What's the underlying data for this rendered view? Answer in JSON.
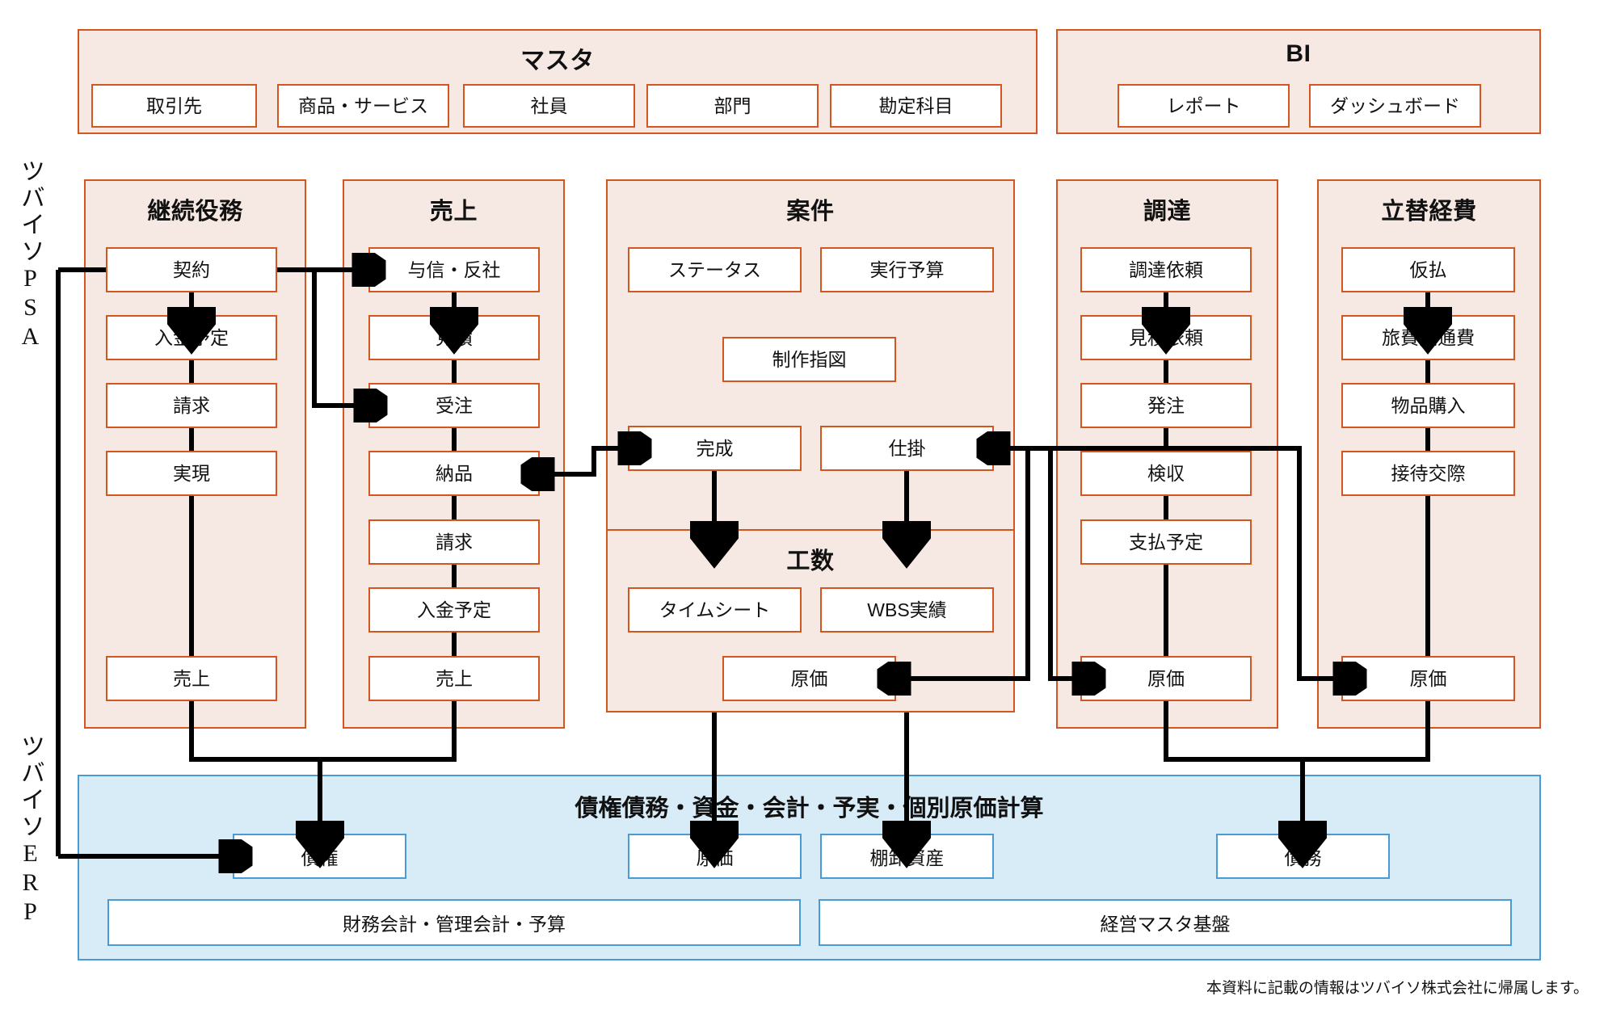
{
  "side_labels": {
    "psa": "ツバイソPSA",
    "erp": "ツバイソERP"
  },
  "footer": "本資料に記載の情報はツバイソ株式会社に帰属します。",
  "colors": {
    "group_fill": "#f6e8e2",
    "group_border": "#d4561f",
    "node_fill": "#ffffff",
    "erp_fill": "#d8ecf7",
    "erp_border": "#4a9ad4",
    "connector": "#000000"
  },
  "top_groups": [
    {
      "id": "master",
      "title": "マスタ",
      "nodes": [
        "取引先",
        "商品・サービス",
        "社員",
        "部門",
        "勘定科目"
      ]
    },
    {
      "id": "bi",
      "title": "BI",
      "nodes": [
        "レポート",
        "ダッシュボード"
      ]
    }
  ],
  "psa_groups": [
    {
      "id": "recurring",
      "title": "継続役務",
      "nodes": [
        "契約",
        "入金予定",
        "請求",
        "実現",
        "売上"
      ]
    },
    {
      "id": "sales",
      "title": "売上",
      "nodes": [
        "与信・反社",
        "見積",
        "受注",
        "納品",
        "請求",
        "入金予定",
        "売上"
      ]
    },
    {
      "id": "project",
      "title": "案件",
      "nodes": [
        "ステータス",
        "実行予算",
        "制作指図",
        "完成",
        "仕掛"
      ]
    },
    {
      "id": "manhours",
      "title": "工数",
      "nodes": [
        "タイムシート",
        "WBS実績",
        "原価"
      ]
    },
    {
      "id": "procurement",
      "title": "調達",
      "nodes": [
        "調達依頼",
        "見積依頼",
        "発注",
        "検収",
        "支払予定",
        "原価"
      ]
    },
    {
      "id": "expenses",
      "title": "立替経費",
      "nodes": [
        "仮払",
        "旅費交通費",
        "物品購入",
        "接待交際",
        "原価"
      ]
    }
  ],
  "erp": {
    "title": "債権債務・資金・会計・予実・個別原価計算",
    "nodes": [
      "債権",
      "原価",
      "棚卸資産",
      "債務"
    ],
    "footers": [
      "財務会計・管理会計・予算",
      "経営マスタ基盤"
    ]
  }
}
